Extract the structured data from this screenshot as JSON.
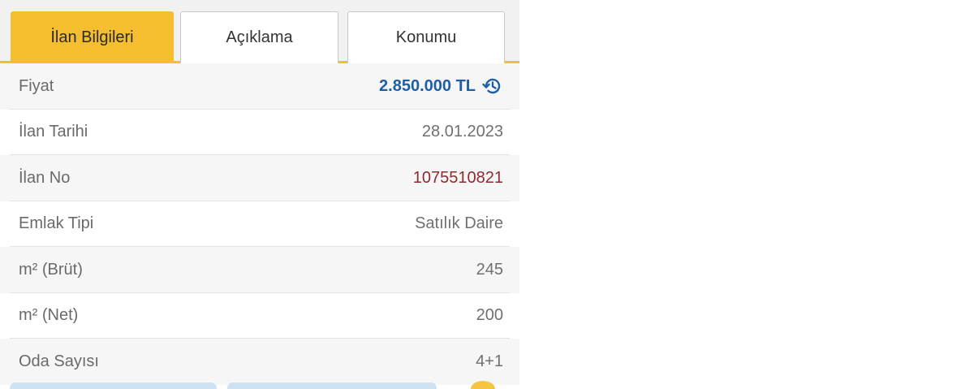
{
  "tabs": {
    "details": "İlan Bilgileri",
    "description": "Açıklama",
    "location": "Konumu"
  },
  "details": {
    "price": {
      "label": "Fiyat",
      "value": "2.850.000 TL",
      "icon": "price-history-icon"
    },
    "listing_date": {
      "label": "İlan Tarihi",
      "value": "28.01.2023"
    },
    "listing_no": {
      "label": "İlan No",
      "value": "1075510821"
    },
    "property_type": {
      "label": "Emlak Tipi",
      "value": "Satılık Daire"
    },
    "gross_area": {
      "label": "m² (Brüt)",
      "value": "245"
    },
    "net_area": {
      "label": "m² (Net)",
      "value": "200"
    },
    "rooms": {
      "label": "Oda Sayısı",
      "value": "4+1"
    }
  },
  "colors": {
    "accent": "#f5be2e",
    "price": "#1f5fa3",
    "listing_no": "#8f2a2f"
  }
}
